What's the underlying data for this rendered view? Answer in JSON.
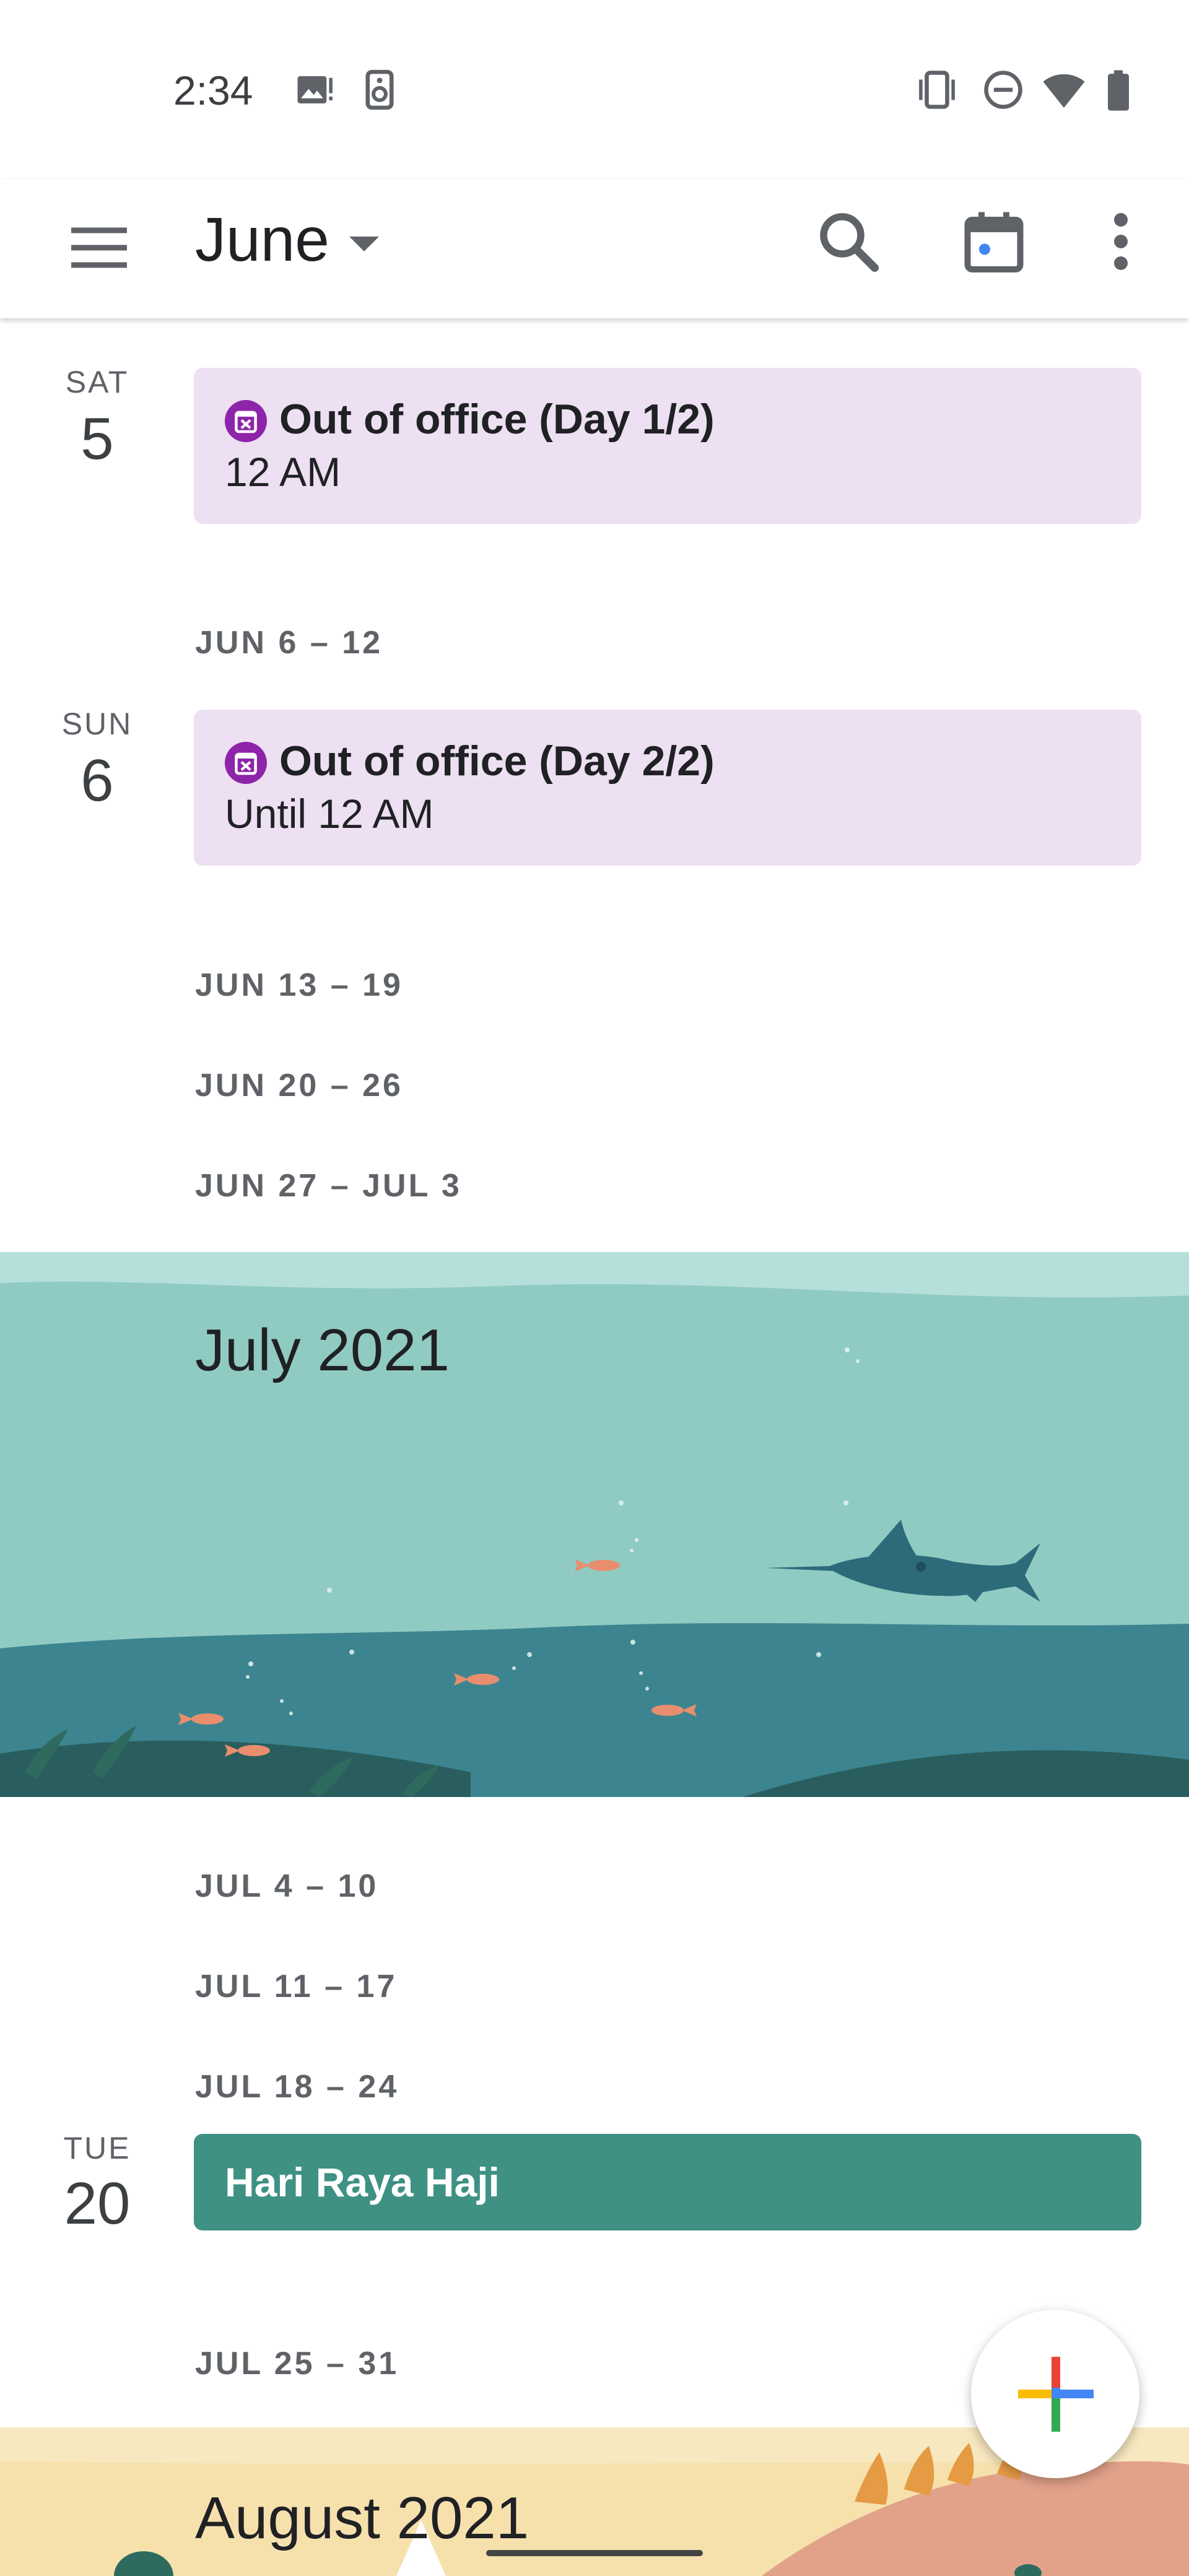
{
  "status_bar": {
    "time": "2:34",
    "left_icons": [
      "image-notification-icon",
      "speaker-icon"
    ],
    "right_icons": [
      "vibrate-icon",
      "do-not-disturb-icon",
      "wifi-icon",
      "battery-icon"
    ]
  },
  "app_bar": {
    "month": "June",
    "icons": [
      "menu-icon",
      "dropdown-caret-icon",
      "search-icon",
      "today-calendar-icon",
      "more-vert-icon"
    ]
  },
  "schedule": {
    "day_sat": {
      "dow": "SAT",
      "num": "5"
    },
    "event_ooo_1": {
      "title": "Out of office (Day 1/2)",
      "time": "12 AM"
    },
    "week_jun_6": "JUN 6 – 12",
    "day_sun": {
      "dow": "SUN",
      "num": "6"
    },
    "event_ooo_2": {
      "title": "Out of office (Day 2/2)",
      "time": "Until 12 AM"
    },
    "week_jun_13": "JUN 13 – 19",
    "week_jun_20": "JUN 20 – 26",
    "week_jun_27": "JUN 27 – JUL 3",
    "july_banner": "July 2021",
    "week_jul_4": "JUL 4 – 10",
    "week_jul_11": "JUL 11 – 17",
    "week_jul_18": "JUL 18 – 24",
    "day_tue": {
      "dow": "TUE",
      "num": "20"
    },
    "event_holiday": {
      "title": "Hari Raya Haji"
    },
    "week_jul_25": "JUL 25 – 31",
    "august_banner": "August 2021"
  },
  "fab": {
    "icon": "add-plus-icon"
  },
  "colors": {
    "ooo_card": "#ede0f2",
    "ooo_icon": "#8e24aa",
    "holiday_card": "#3e9183",
    "today_dot": "#4285f4"
  }
}
